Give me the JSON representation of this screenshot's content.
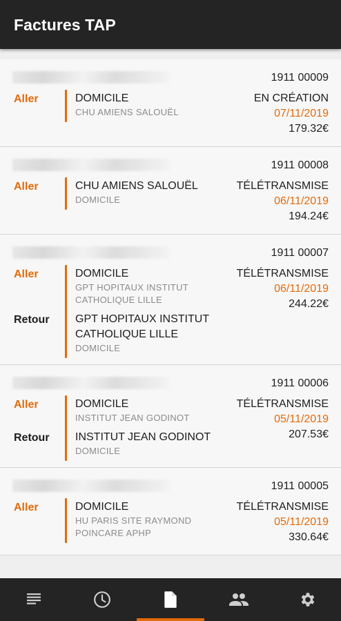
{
  "header": {
    "title": "Factures TAP"
  },
  "invoices": [
    {
      "number": "1911 00009",
      "status": "EN CRÉATION",
      "date": "07/11/2019",
      "amount": "179.32€",
      "legs": [
        {
          "direction": "Aller",
          "from": "DOMICILE",
          "to": "CHU AMIENS SALOUËL"
        }
      ]
    },
    {
      "number": "1911 00008",
      "status": "TÉLÉTRANSMISE",
      "date": "06/11/2019",
      "amount": "194.24€",
      "legs": [
        {
          "direction": "Aller",
          "from": "CHU AMIENS SALOUËL",
          "to": "DOMICILE"
        }
      ]
    },
    {
      "number": "1911 00007",
      "status": "TÉLÉTRANSMISE",
      "date": "06/11/2019",
      "amount": "244.22€",
      "legs": [
        {
          "direction": "Aller",
          "from": "DOMICILE",
          "to": "GPT HOPITAUX INSTITUT CATHOLIQUE LILLE"
        },
        {
          "direction": "Retour",
          "from": "GPT HOPITAUX INSTITUT CATHOLIQUE LILLE",
          "to": "DOMICILE"
        }
      ]
    },
    {
      "number": "1911 00006",
      "status": "TÉLÉTRANSMISE",
      "date": "05/11/2019",
      "amount": "207.53€",
      "legs": [
        {
          "direction": "Aller",
          "from": "DOMICILE",
          "to": "INSTITUT JEAN GODINOT"
        },
        {
          "direction": "Retour",
          "from": "INSTITUT JEAN GODINOT",
          "to": "DOMICILE"
        }
      ]
    },
    {
      "number": "1911 00005",
      "status": "TÉLÉTRANSMISE",
      "date": "05/11/2019",
      "amount": "330.64€",
      "legs": [
        {
          "direction": "Aller",
          "from": "DOMICILE",
          "to": "HU PARIS SITE RAYMOND POINCARE APHP"
        }
      ]
    }
  ],
  "bottom_nav": [
    {
      "icon": "list-icon",
      "active": false
    },
    {
      "icon": "clock-icon",
      "active": false
    },
    {
      "icon": "document-icon",
      "active": true
    },
    {
      "icon": "people-icon",
      "active": false
    },
    {
      "icon": "gear-icon",
      "active": false
    }
  ],
  "colors": {
    "accent": "#e26b0a",
    "appbar": "#242424",
    "background": "#efefef",
    "card": "#f7f7f7",
    "secondary_text": "#8b8b8b"
  }
}
